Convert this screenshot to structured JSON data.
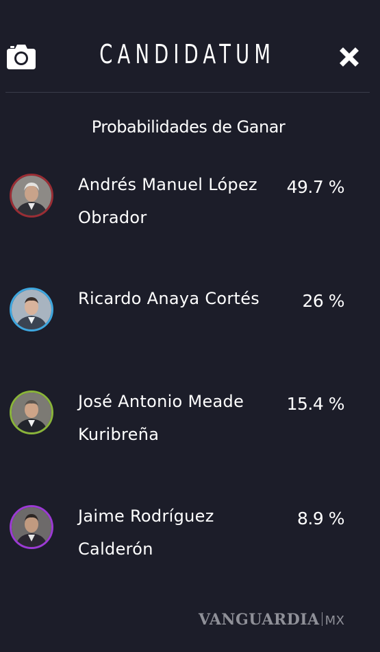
{
  "app": {
    "title": "CANDIDATUM"
  },
  "icons": {
    "camera": "camera-icon",
    "close": "close-icon"
  },
  "subtitle": "Probabilidades de Ganar",
  "candidates": [
    {
      "name": "Andrés Manuel López Obrador",
      "percent": "49.7 %",
      "ring_color": "#9a2d34"
    },
    {
      "name": "Ricardo Anaya Cortés",
      "percent": "26 %",
      "ring_color": "#3ea7df"
    },
    {
      "name": "José Antonio Meade Kuribreña",
      "percent": "15.4 %",
      "ring_color": "#8ab43a"
    },
    {
      "name": "Jaime Rodríguez Calderón",
      "percent": "8.9 %",
      "ring_color": "#9c3ad4"
    }
  ],
  "watermark": {
    "brand": "VANGUARDIA",
    "suffix": "MX"
  }
}
